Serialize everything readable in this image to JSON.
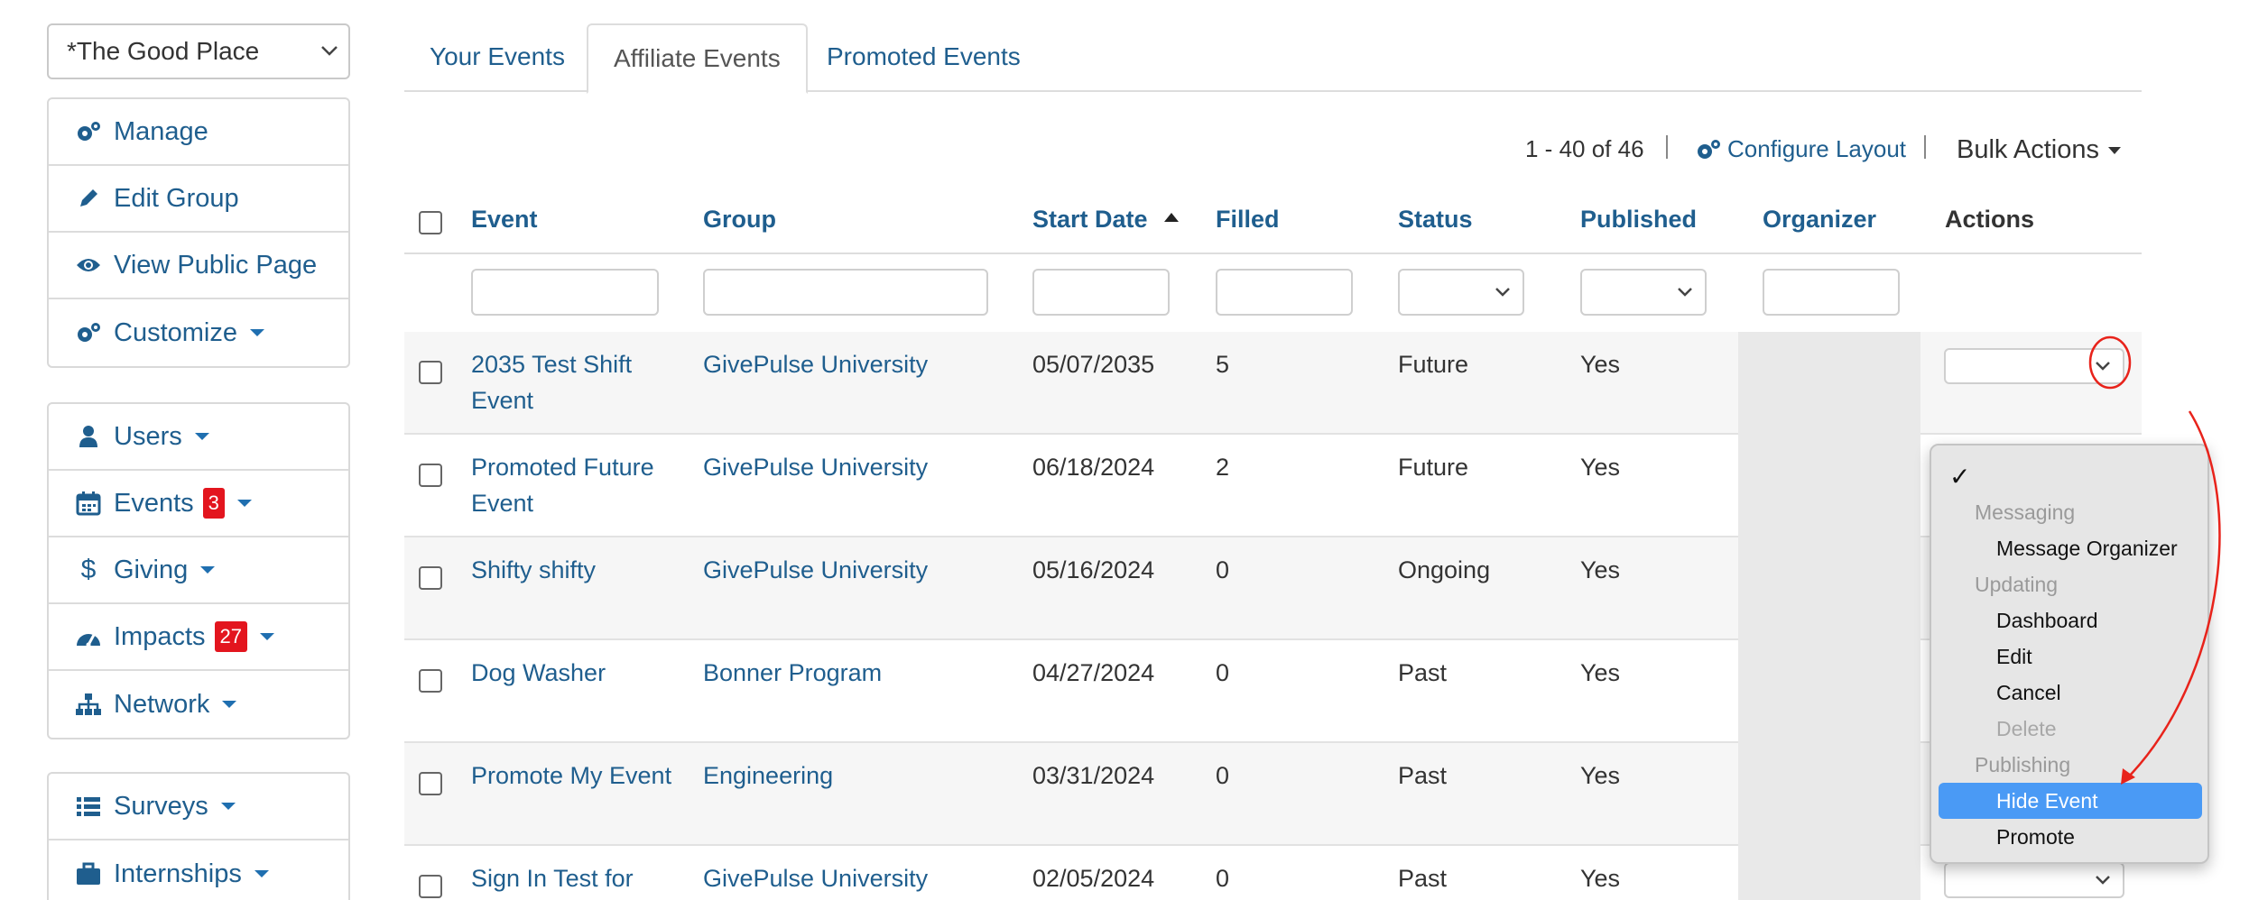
{
  "group_selector": {
    "value": "*The Good Place"
  },
  "sidebar": {
    "group1": [
      {
        "label": "Manage",
        "icon": "gears-icon",
        "caret": false
      },
      {
        "label": "Edit Group",
        "icon": "pencil-icon",
        "caret": false
      },
      {
        "label": "View Public Page",
        "icon": "eye-icon",
        "caret": false
      },
      {
        "label": "Customize",
        "icon": "gears-icon",
        "caret": true
      }
    ],
    "group2": [
      {
        "label": "Users",
        "icon": "user-icon",
        "caret": true,
        "badge": ""
      },
      {
        "label": "Events",
        "icon": "calendar-icon",
        "caret": true,
        "badge": "3"
      },
      {
        "label": "Giving",
        "icon": "dollar-icon",
        "caret": true,
        "badge": ""
      },
      {
        "label": "Impacts",
        "icon": "dashboard-icon",
        "caret": true,
        "badge": "27"
      },
      {
        "label": "Network",
        "icon": "sitemap-icon",
        "caret": true,
        "badge": ""
      }
    ],
    "group3": [
      {
        "label": "Surveys",
        "icon": "list-icon",
        "caret": true
      },
      {
        "label": "Internships",
        "icon": "briefcase-icon",
        "caret": true
      }
    ]
  },
  "tabs": [
    {
      "label": "Your Events",
      "active": false
    },
    {
      "label": "Affiliate Events",
      "active": true
    },
    {
      "label": "Promoted Events",
      "active": false
    }
  ],
  "toolbar": {
    "range": "1 - 40 of 46",
    "configure_layout": "Configure Layout",
    "bulk_actions": "Bulk Actions"
  },
  "table": {
    "columns": [
      "Event",
      "Group",
      "Start Date",
      "Filled",
      "Status",
      "Published",
      "Organizer",
      "Actions"
    ],
    "sorted_column": "Start Date",
    "sort_direction": "ascending",
    "rows": [
      {
        "event": [
          "2035 Test Shift",
          "Event"
        ],
        "group": "GivePulse University",
        "start_date": "05/07/2035",
        "filled": "5",
        "status": "Future",
        "published": "Yes"
      },
      {
        "event": [
          "Promoted Future",
          "Event"
        ],
        "group": "GivePulse University",
        "start_date": "06/18/2024",
        "filled": "2",
        "status": "Future",
        "published": "Yes"
      },
      {
        "event": [
          "Shifty shifty",
          ""
        ],
        "group": "GivePulse University",
        "start_date": "05/16/2024",
        "filled": "0",
        "status": "Ongoing",
        "published": "Yes"
      },
      {
        "event": [
          "Dog Washer",
          ""
        ],
        "group": "Bonner Program",
        "start_date": "04/27/2024",
        "filled": "0",
        "status": "Past",
        "published": "Yes"
      },
      {
        "event": [
          "Promote My Event",
          ""
        ],
        "group": "Engineering",
        "start_date": "03/31/2024",
        "filled": "0",
        "status": "Past",
        "published": "Yes"
      },
      {
        "event": [
          "Sign In Test for",
          ""
        ],
        "group": "GivePulse University",
        "start_date": "02/05/2024",
        "filled": "0",
        "status": "Past",
        "published": "Yes"
      }
    ]
  },
  "actions_menu": {
    "check": "✓",
    "items": [
      {
        "label": "Messaging",
        "type": "group"
      },
      {
        "label": "Message Organizer",
        "type": "item"
      },
      {
        "label": "Updating",
        "type": "group"
      },
      {
        "label": "Dashboard",
        "type": "item"
      },
      {
        "label": "Edit",
        "type": "item"
      },
      {
        "label": "Cancel",
        "type": "item"
      },
      {
        "label": "Delete",
        "type": "disabled"
      },
      {
        "label": "Publishing",
        "type": "group"
      },
      {
        "label": "Hide Event",
        "type": "selected"
      },
      {
        "label": "Promote",
        "type": "item"
      }
    ]
  },
  "colors": {
    "link": "#1f5e8e",
    "badge": "#e3151e",
    "menu_highlight": "#4a9af5",
    "annotation": "#e8231b"
  }
}
